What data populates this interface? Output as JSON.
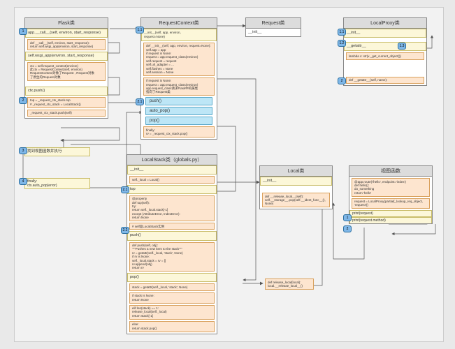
{
  "flask": {
    "title": "Flask类",
    "row_call": "app.__call__(self, environ, start_response)",
    "call_body": "def __call__(self, environ, start_response):\n    return self.wsgi_app(environ, start_response)",
    "row_wsgi": "self.wsgi_app(environ, start_response)",
    "wsgi_body": "ctx = self.request_context(environ)\n此ctx = RequestContext(self, environ)\nRequestContext对象了Request , Request对象\n了原生的Request对象",
    "ctx_push": "ctx.push()",
    "ctx_push_body": "top = _request_ctx_stack.top\n# _request_ctx_stack = LocalStack()",
    "ctx_push_line2": "_request_ctx_stack.push(self)",
    "dispatch": "找到视图函数并执行",
    "finally_label": "finally:\nctx.auto_pop(error)"
  },
  "reqctx": {
    "title": "RequestContext类",
    "init_hdr": "__init__(self, app, environ,\n    request=None)",
    "init_body": "def __init__(self, app, environ, request=None):\n    self.app = app\n    if request is None:\n        request = app.request_class(environ)\n    self.request = request\n    self.url_adapter = ...\n    self.flashes = None\n    self.session = None",
    "init_note": "if request is None:\n    request = app.request_class(environ)\napp.request_class请求Flask中的属性\n指向了Request类",
    "btn_push": "push()",
    "btn_auto": "auto_pop()",
    "btn_pop": "pop()",
    "finally_body": "finally:\n    rv = _request_ctx_stack.pop()"
  },
  "request": {
    "title": "Request类",
    "init": "__init__"
  },
  "localproxy": {
    "title": "LocalProxy类",
    "init": "__init__",
    "getattr": "__getattr__",
    "lambda": "lambda x: str(x._get_current_object())",
    "getattr_body": "def __getattr__(self, name):"
  },
  "localstack": {
    "title": "LocalStack类（globals.py）",
    "init": "__init__",
    "init_body": "self._local = Local()",
    "top": "top",
    "top_body": "@property\ndef top(self):\n    try:\n        return self._local.stack[-1]\n    except (AttributeError, IndexError):\n        return None",
    "top_note": "# self是LocalStack实例",
    "push": "push()",
    "push_body": "def push(self, obj):\n    \"\"\"Pushes a new item to the stack\"\"\"\n    rv = getattr(self._local, 'stack', None)\n    if rv is None:\n        self._local.stack = rv = []\n    rv.append(obj)\n    return rv",
    "pop": "pop()",
    "pop_stack": "stack = getattr(self._local, 'stack', None)",
    "pop_if": "if stack is None:\n    return None",
    "pop_elif": "elif len(stack) == 1:\n    release_local(self._local)\n    return stack[-1]",
    "pop_else": "else:\n    return stack.pop()"
  },
  "local": {
    "title": "Local类",
    "init": "__init__",
    "release": "def __release_local__(self):\n    self.__storage__.pop(self.__ident_func__(), None)"
  },
  "viewfn": {
    "title": "视图函数",
    "body": "@app.route('/hello', endpoint='index')\ndef hello():\n    do_something\n    return 'hello'",
    "req_line": "request = LocalProxy(partial(_lookup_req_object, 'request'))",
    "p1": "print(request)",
    "p2": "print(request.method)"
  },
  "release_local": "def release_local(local):\n    local.__release_local__()",
  "badges": {
    "b1": "1",
    "b2": "2",
    "b2_1": "2.1",
    "b2_2": "2.2",
    "b3": "3",
    "b4": "4",
    "b1_1_top": "1.1",
    "b1_2": "1.2",
    "b1_3": "1.3",
    "b1_1_proxy": "1.1"
  }
}
